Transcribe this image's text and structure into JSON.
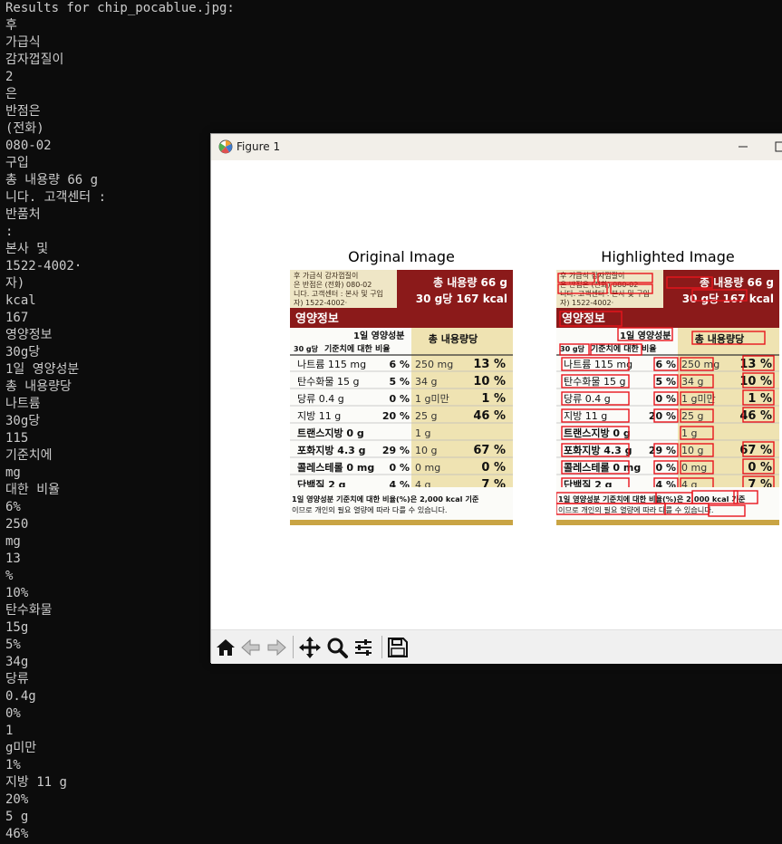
{
  "terminal": {
    "lines": [
      "Results for chip_pocablue.jpg:",
      "후",
      "가급식",
      "감자껍질이",
      "2",
      "은",
      "반점은",
      "(전화)",
      "080-02",
      "구입",
      "총 내용량 66 g",
      "니다. 고객센터 :",
      "반품처",
      ":",
      "본사 및",
      "1522-4002·",
      "자)",
      "kcal",
      "167",
      "영양정보",
      "30g당",
      "1일 영양성분",
      "총 내용량당",
      "나트륨",
      "30g당",
      "115",
      "기준치에",
      "mg",
      "대한 비율",
      "6%",
      "250",
      "mg",
      "13",
      "%",
      "10%",
      "탄수화물",
      "15g",
      "5%",
      "34g",
      "당류",
      "0.4g",
      "0%",
      "1",
      "g미만",
      "1%",
      "지방 11 g",
      "20%",
      "5 g",
      "46%"
    ]
  },
  "figure": {
    "window_title": "Figure 1",
    "subplots": [
      {
        "title": "Original Image"
      },
      {
        "title": "Highlighted Image"
      }
    ],
    "image": {
      "header_left": "영양정보",
      "total_label": "총 내용량 66 g",
      "per_label": "30 g당 167 kcal",
      "col_head_a": "1일 영양성분",
      "col_head_b": "기준치에 대한 비율",
      "col_head_c": "총 내용량당",
      "per30": "30 g당",
      "rows": [
        {
          "name": "나트륨 115 mg",
          "pct": "6 %",
          "total": "250 mg",
          "tpct": "13 %"
        },
        {
          "name": "탄수화물 15 g",
          "pct": "5 %",
          "total": "34 g",
          "tpct": "10 %"
        },
        {
          "name": "당류 0.4 g",
          "pct": "0 %",
          "total": "1 g미만",
          "tpct": "1 %"
        },
        {
          "name": "지방 11 g",
          "pct": "20 %",
          "total": "25 g",
          "tpct": "46 %"
        },
        {
          "name": "트랜스지방 0 g",
          "pct": "",
          "total": "1 g",
          "tpct": ""
        },
        {
          "name": "포화지방 4.3 g",
          "pct": "29 %",
          "total": "10 g",
          "tpct": "67 %"
        },
        {
          "name": "콜레스테롤 0 mg",
          "pct": "0 %",
          "total": "0 mg",
          "tpct": "0 %"
        },
        {
          "name": "단백질 2 g",
          "pct": "4 %",
          "total": "4 g",
          "tpct": "7 %"
        }
      ],
      "footer1": "1일 영양성분 기준치에 대한 비율(%)은 2,000 kcal 기준",
      "footer2": "이므로 개인의 필요 열량에 따라 다를 수 있습니다.",
      "top1": "후 가급식 감자껍질이",
      "top2": "은 반점은 (전화) 080-02",
      "top3": "니다. 고객센터 : 본사 및 구입",
      "top4": "자) 1522-4002·"
    }
  },
  "colors": {
    "terminal_bg": "#0c0c0c",
    "terminal_text": "#cccccc",
    "highlight_box": "#e8141c",
    "label_header": "#8b1a1a",
    "package_gold": "#d9b552"
  },
  "toolbar": {
    "buttons": [
      "home-icon",
      "back-icon",
      "forward-icon",
      "pan-icon",
      "zoom-icon",
      "configure-icon",
      "save-icon"
    ]
  }
}
